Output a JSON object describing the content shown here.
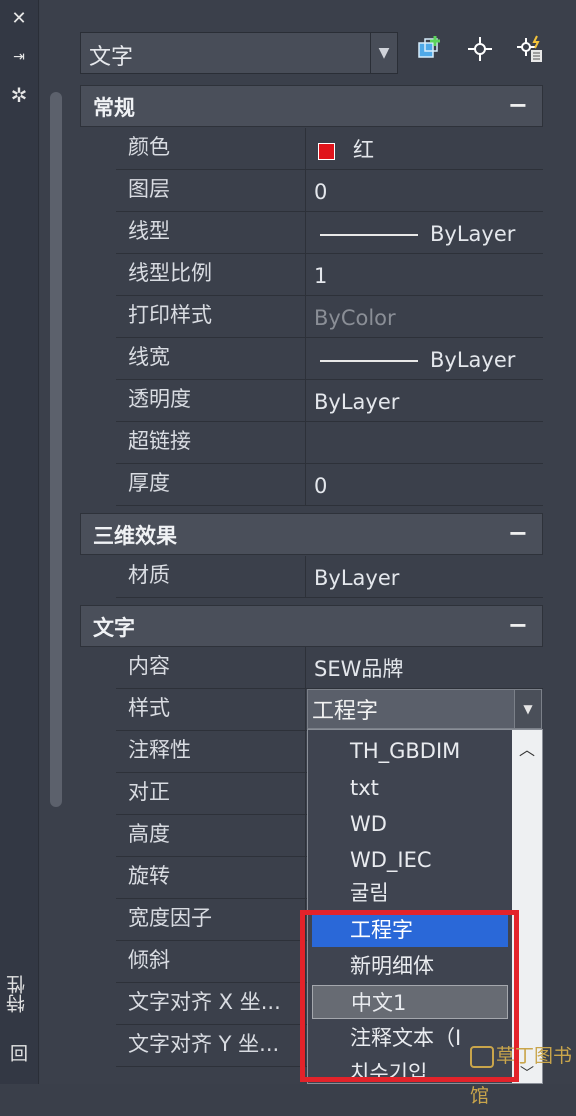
{
  "left_bar": {
    "close_icon": "close-icon",
    "pin_icon": "pin-icon",
    "settings_icon": "settings-icon",
    "vertical_title": "特性",
    "bottom_icon": "回"
  },
  "header": {
    "object_type": "文字",
    "tools": [
      "quick-select-icon",
      "select-objects-icon",
      "toggle-pickadd-icon"
    ]
  },
  "sections": {
    "general": {
      "title": "常规",
      "collapse": "−",
      "rows": [
        {
          "key": "颜色",
          "value": "红",
          "color": "#e0141b"
        },
        {
          "key": "图层",
          "value": "0"
        },
        {
          "key": "线型",
          "value": "ByLayer",
          "has_line": true
        },
        {
          "key": "线型比例",
          "value": "1"
        },
        {
          "key": "打印样式",
          "value": "ByColor",
          "dim": true
        },
        {
          "key": "线宽",
          "value": "ByLayer",
          "has_line": true
        },
        {
          "key": "透明度",
          "value": "ByLayer"
        },
        {
          "key": "超链接",
          "value": ""
        },
        {
          "key": "厚度",
          "value": "0"
        }
      ]
    },
    "effects3d": {
      "title": "三维效果",
      "collapse": "−",
      "rows": [
        {
          "key": "材质",
          "value": "ByLayer"
        }
      ]
    },
    "text": {
      "title": "文字",
      "collapse": "−",
      "rows": [
        {
          "key": "内容",
          "value": "SEW品牌"
        },
        {
          "key": "样式",
          "value": "工程字"
        },
        {
          "key": "注释性",
          "value": ""
        },
        {
          "key": "对正",
          "value": ""
        },
        {
          "key": "高度",
          "value": ""
        },
        {
          "key": "旋转",
          "value": ""
        },
        {
          "key": "宽度因子",
          "value": ""
        },
        {
          "key": "倾斜",
          "value": ""
        },
        {
          "key": "文字对齐 X 坐...",
          "value": ""
        },
        {
          "key": "文字对齐 Y 坐...",
          "value": ""
        }
      ]
    }
  },
  "style_dropdown": {
    "selected": "工程字",
    "options": [
      "TH_GBDIM",
      "txt",
      "WD",
      "WD_IEC",
      "굴림",
      "工程字",
      "新明细体",
      "中文1",
      "注释文本（I",
      "치수기입"
    ]
  },
  "watermark": "草丁图书馆"
}
